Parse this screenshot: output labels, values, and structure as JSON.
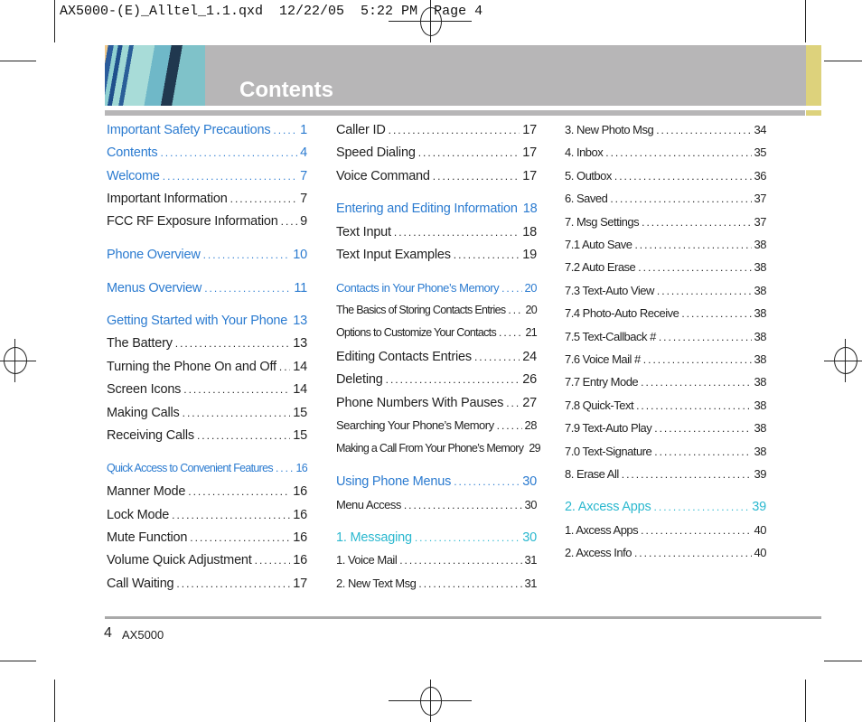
{
  "slug": "AX5000-(E)_Alltel_1.1.qxd  12/22/05  5:22 PM  Page 4",
  "header": {
    "title": "Contents"
  },
  "colors": {
    "heading": "#2b7bd0",
    "subheading": "#2bb8cf",
    "band": "#b7b6b7",
    "accent": "#ddd27c"
  },
  "columns": [
    [
      {
        "t": "Important Safety Precautions",
        "p": "1",
        "s": "head"
      },
      {
        "t": "Contents",
        "p": "4",
        "s": "head"
      },
      {
        "t": "Welcome",
        "p": "7",
        "s": "head"
      },
      {
        "t": "Important Information",
        "p": "7"
      },
      {
        "t": "FCC RF Exposure Information",
        "p": "9"
      },
      {
        "t": "Phone Overview",
        "p": "10",
        "s": "head"
      },
      {
        "t": "Menus Overview",
        "p": "11",
        "s": "head"
      },
      {
        "t": "Getting Started with Your Phone",
        "p": "13",
        "s": "head"
      },
      {
        "t": "The Battery",
        "p": "13"
      },
      {
        "t": "Turning the Phone On and Off",
        "p": "14"
      },
      {
        "t": "Screen Icons",
        "p": "14"
      },
      {
        "t": "Making Calls",
        "p": "15"
      },
      {
        "t": "Receiving Calls",
        "p": "15"
      },
      {
        "t": "Quick Access to Convenient Features",
        "p": "16",
        "s": "head xsmall"
      },
      {
        "t": "Manner Mode",
        "p": "16"
      },
      {
        "t": "Lock Mode",
        "p": "16"
      },
      {
        "t": "Mute Function",
        "p": "16"
      },
      {
        "t": "Volume Quick Adjustment",
        "p": "16"
      },
      {
        "t": "Call Waiting",
        "p": "17"
      }
    ],
    [
      {
        "t": "Caller ID",
        "p": "17"
      },
      {
        "t": "Speed Dialing",
        "p": "17"
      },
      {
        "t": "Voice Command",
        "p": "17"
      },
      {
        "t": "Entering and Editing Information",
        "p": "18",
        "s": "head"
      },
      {
        "t": "Text Input",
        "p": "18"
      },
      {
        "t": "Text Input Examples",
        "p": "19"
      },
      {
        "t": "Contacts in Your Phone’s Memory",
        "p": "20",
        "s": "head small"
      },
      {
        "t": "The Basics of Storing Contacts Entries",
        "p": "20",
        "s": "xsmall"
      },
      {
        "t": "Options to Customize Your Contacts",
        "p": "21",
        "s": "xsmall"
      },
      {
        "t": "Editing Contacts Entries",
        "p": "24"
      },
      {
        "t": "Deleting",
        "p": "26"
      },
      {
        "t": "Phone Numbers With Pauses",
        "p": "27"
      },
      {
        "t": "Searching Your Phone’s Memory",
        "p": "28",
        "s": "small"
      },
      {
        "t": "Making a Call From Your Phone’s Memory",
        "p": "29",
        "s": "xsmall"
      },
      {
        "t": "Using Phone Menus",
        "p": "30",
        "s": "head"
      },
      {
        "t": "Menu Access",
        "p": "30",
        "s": "small"
      },
      {
        "t": "1. Messaging",
        "p": "30",
        "s": "cyan"
      },
      {
        "t": "1. Voice Mail",
        "p": "31",
        "s": "small"
      },
      {
        "t": "2. New Text Msg",
        "p": "31",
        "s": "small"
      }
    ],
    [
      {
        "t": "3. New Photo Msg",
        "p": "34",
        "s": "small"
      },
      {
        "t": "4. Inbox",
        "p": "35",
        "s": "small"
      },
      {
        "t": "5. Outbox",
        "p": "36",
        "s": "small"
      },
      {
        "t": "6. Saved",
        "p": "37",
        "s": "small"
      },
      {
        "t": "7. Msg Settings",
        "p": "37",
        "s": "small"
      },
      {
        "t": "7.1 Auto Save",
        "p": "38",
        "s": "small"
      },
      {
        "t": "7.2 Auto Erase",
        "p": "38",
        "s": "small"
      },
      {
        "t": "7.3 Text-Auto View",
        "p": "38",
        "s": "small"
      },
      {
        "t": "7.4 Photo-Auto Receive",
        "p": "38",
        "s": "small"
      },
      {
        "t": "7.5 Text-Callback #",
        "p": "38",
        "s": "small"
      },
      {
        "t": "7.6 Voice Mail #",
        "p": "38",
        "s": "small"
      },
      {
        "t": "7.7 Entry Mode",
        "p": "38",
        "s": "small"
      },
      {
        "t": "7.8 Quick-Text",
        "p": "38",
        "s": "small"
      },
      {
        "t": "7.9 Text-Auto Play",
        "p": "38",
        "s": "small"
      },
      {
        "t": "7.0 Text-Signature",
        "p": "38",
        "s": "small"
      },
      {
        "t": "8. Erase All",
        "p": "39",
        "s": "small"
      },
      {
        "t": "2. Axcess Apps",
        "p": "39",
        "s": "cyan"
      },
      {
        "t": "1. Axcess Apps",
        "p": "40",
        "s": "small"
      },
      {
        "t": "2. Axcess Info",
        "p": "40",
        "s": "small"
      }
    ]
  ],
  "footer": {
    "page_number": "4",
    "model": "AX5000"
  }
}
